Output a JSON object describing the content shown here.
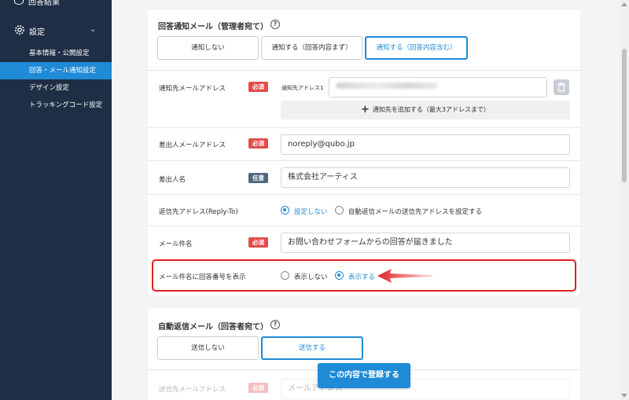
{
  "sidebar": {
    "top_item": "回答結果",
    "settings_label": "設定",
    "items": [
      {
        "label": "基本情報・公開設定"
      },
      {
        "label": "回答・メール通知設定"
      },
      {
        "label": "デザイン設定"
      },
      {
        "label": "トラッキングコード設定"
      }
    ]
  },
  "admin_mail": {
    "title": "回答通知メール（管理者宛て）",
    "help": "?",
    "options": [
      "通知しない",
      "通知する（回答内容まず）",
      "通知する（回答内容含む）"
    ],
    "selected_index": 2,
    "recipient": {
      "label": "通知先メールアドレス",
      "badge": "必須",
      "sub_label": "通知先アドレス1",
      "add_label": "通知先を追加する（最大3アドレスまで）"
    },
    "sender_email": {
      "label": "差出人メールアドレス",
      "badge": "必須",
      "value": "noreply@qubo.jp"
    },
    "sender_name": {
      "label": "差出人名",
      "badge": "任意",
      "value": "株式会社アーティス"
    },
    "reply_to": {
      "label": "返信先アドレス(Reply-To)",
      "options": [
        "設定しない",
        "自動返信メールの送信先アドレスを設定する"
      ],
      "selected_index": 0
    },
    "subject": {
      "label": "メール件名",
      "badge": "必須",
      "value": "お問い合わせフォームからの回答が届きました"
    },
    "show_number": {
      "label": "メール件名に回答番号を表示",
      "options": [
        "表示しない",
        "表示する"
      ],
      "selected_index": 1
    }
  },
  "auto_reply": {
    "title": "自動返信メール（回答者宛て）",
    "help": "?",
    "options": [
      "送信しない",
      "送信する"
    ],
    "selected_index": 1,
    "faded_label": "送信先メールアドレス",
    "faded_badge": "必須",
    "faded_value": "メールアドレス"
  },
  "submit_label": "この内容で登録する",
  "colors": {
    "accent": "#1f8ad6",
    "sidebar": "#1e2f45",
    "required": "#e24b4b",
    "optional": "#52687f",
    "highlight": "#e02222"
  }
}
